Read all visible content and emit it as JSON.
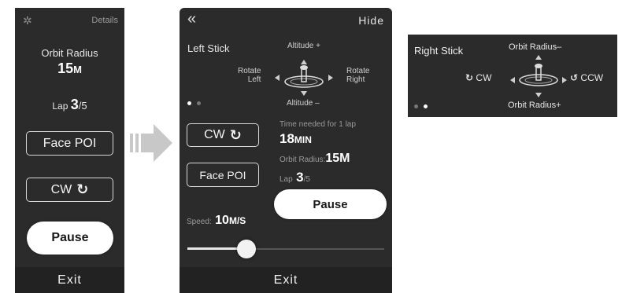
{
  "panel1": {
    "details_label": "Details",
    "orbit_radius_label": "Orbit Radius",
    "orbit_radius_value": "15",
    "orbit_radius_unit": "M",
    "lap_label": "Lap",
    "lap_current": "3",
    "lap_total": "/5",
    "face_poi_label": "Face POI",
    "cw_label": "CW",
    "pause_label": "Pause",
    "exit_label": "Exit"
  },
  "panel2": {
    "collapse_glyph": "«",
    "hide_label": "Hide",
    "left_stick_label": "Left Stick",
    "altitude_plus": "Altitude +",
    "altitude_minus": "Altitude –",
    "rotate_left": "Rotate\nLeft",
    "rotate_right": "Rotate\nRight",
    "cw_label": "CW",
    "face_poi_label": "Face POI",
    "time_needed_label": "Time needed for 1 lap",
    "time_value": "18",
    "time_unit": "MIN",
    "orbit_radius_label": "Orbit Radius:",
    "orbit_radius_value": "15M",
    "lap_label": "Lap",
    "lap_current": "3",
    "lap_total": "/5",
    "pause_label": "Pause",
    "speed_label": "Speed:",
    "speed_value": "10",
    "speed_unit": "M/S",
    "speed_slider_fraction": 0.3,
    "exit_label": "Exit"
  },
  "panel3": {
    "right_stick_label": "Right Stick",
    "orbit_radius_minus": "Orbit Radius–",
    "orbit_radius_plus": "Orbit Radius+",
    "cw_label": "CW",
    "ccw_label": "CCW"
  },
  "colors": {
    "panel_bg": "#2b2b2b",
    "footer_bg": "#222222",
    "arrow_gray": "#c8c8c8"
  }
}
